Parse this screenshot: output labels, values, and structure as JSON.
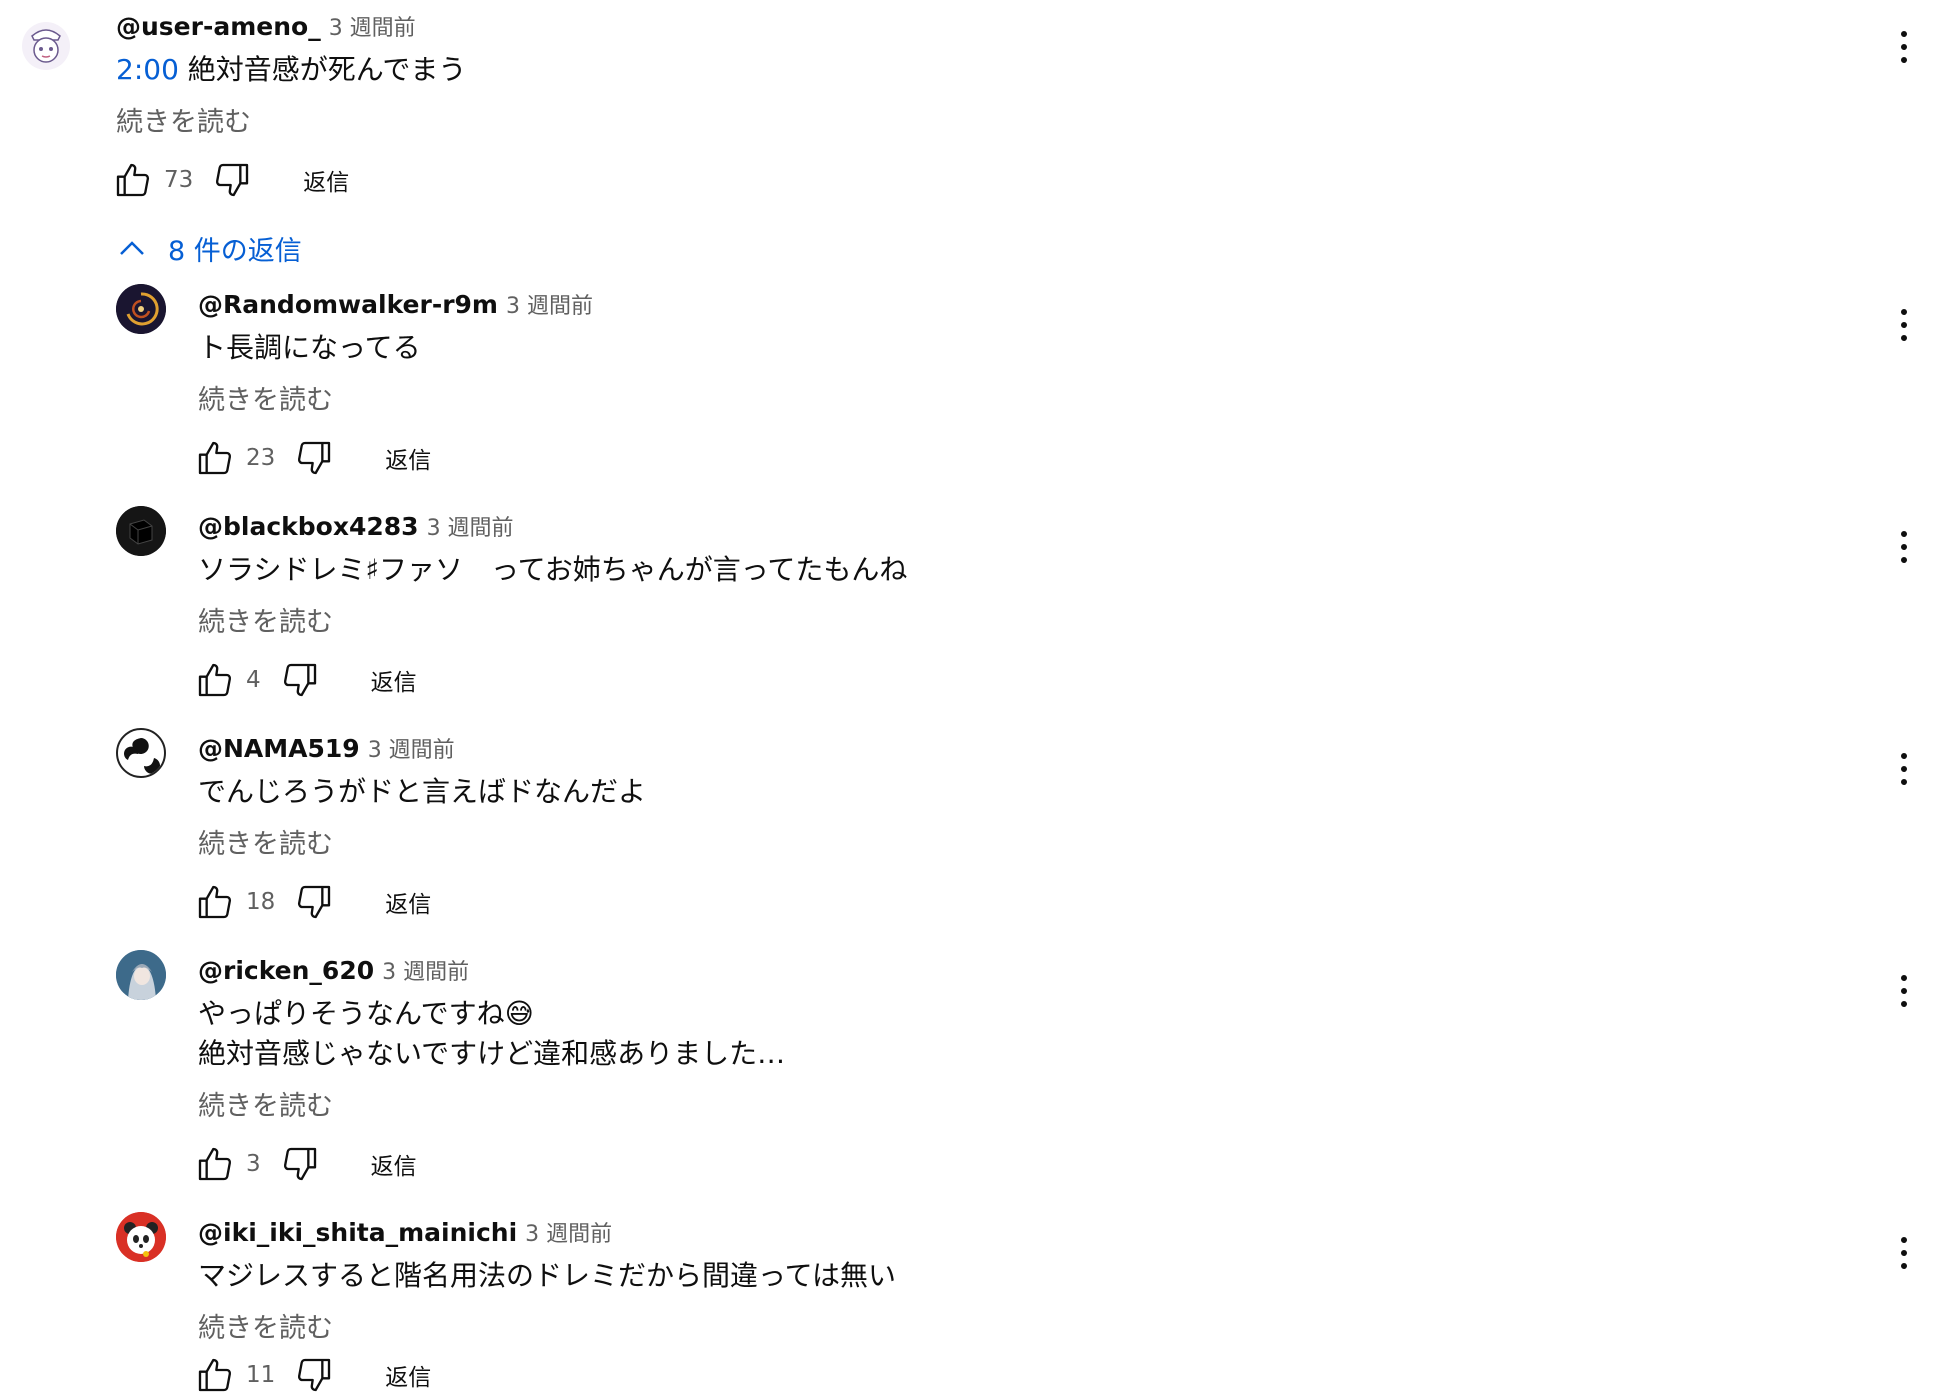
{
  "top_comment": {
    "author": "@user-ameno_",
    "time": "3 週間前",
    "timestamp_link": "2:00",
    "text": "絶対音感が死んでまう",
    "read_more": "続きを読む",
    "likes": "73",
    "reply_label": "返信"
  },
  "replies_toggle": {
    "label": "8 件の返信"
  },
  "replies": [
    {
      "author": "@Randomwalker-r9m",
      "time": "3 週間前",
      "text": "ト長調になってる",
      "read_more": "続きを読む",
      "likes": "23",
      "reply_label": "返信"
    },
    {
      "author": "@blackbox4283",
      "time": "3 週間前",
      "text": "ソラシドレミ♯ファソ　ってお姉ちゃんが言ってたもんね",
      "read_more": "続きを読む",
      "likes": "4",
      "reply_label": "返信"
    },
    {
      "author": "@NAMA519",
      "time": "3 週間前",
      "text": "でんじろうがドと言えばドなんだよ",
      "read_more": "続きを読む",
      "likes": "18",
      "reply_label": "返信"
    },
    {
      "author": "@ricken_620",
      "time": "3 週間前",
      "text": "やっぱりそうなんですね😅",
      "text2": "絶対音感じゃないですけど違和感ありました…",
      "read_more": "続きを読む",
      "likes": "3",
      "reply_label": "返信"
    },
    {
      "author": "@iki_iki_shita_mainichi",
      "time": "3 週間前",
      "text": "マジレスすると階名用法のドレミだから間違っては無い",
      "read_more": "続きを読む",
      "likes": "11",
      "reply_label": "返信"
    }
  ],
  "colors": {
    "link": "#065fd4",
    "secondary_text": "#606060",
    "primary_text": "#0f0f0f"
  }
}
